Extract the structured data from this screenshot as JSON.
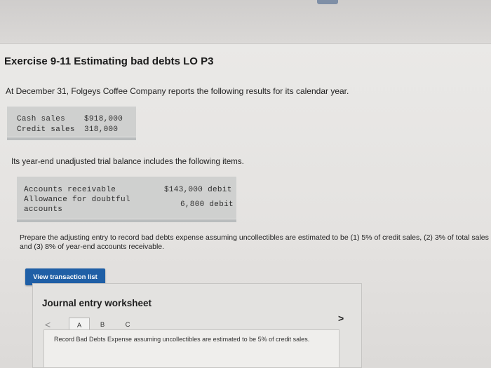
{
  "exercise": {
    "title": "Exercise 9-11 Estimating bad debts LO P3",
    "intro": "At December 31, Folgeys Coffee Company reports the following results for its calendar year."
  },
  "sales": [
    {
      "label": "Cash sales  ",
      "value": "$918,000"
    },
    {
      "label": "Credit sales",
      "value": "318,000"
    }
  ],
  "trial_balance": {
    "intro": "Its year-end unadjusted trial balance includes the following items.",
    "line1": "Accounts receivable",
    "line2": "Allowance for doubtful",
    "line3": "accounts",
    "value1": "$143,000 debit",
    "value2": "6,800 debit"
  },
  "prompt": "Prepare the adjusting entry to record bad debts expense assuming uncollectibles are estimated to be (1) 5% of credit sales, (2) 3% of total sales and (3) 8% of year-end accounts receivable.",
  "buttons": {
    "view_transactions": "View transaction list"
  },
  "worksheet": {
    "title": "Journal entry worksheet",
    "prev": "<",
    "next": ">",
    "tabs": [
      "A",
      "B",
      "C"
    ],
    "entry_text": "Record Bad Debts Expense assuming uncollectibles are estimated to be 5% of credit sales."
  },
  "colors": {
    "button_bg": "#1f5fa6",
    "box_bg": "#cfd0cf"
  }
}
